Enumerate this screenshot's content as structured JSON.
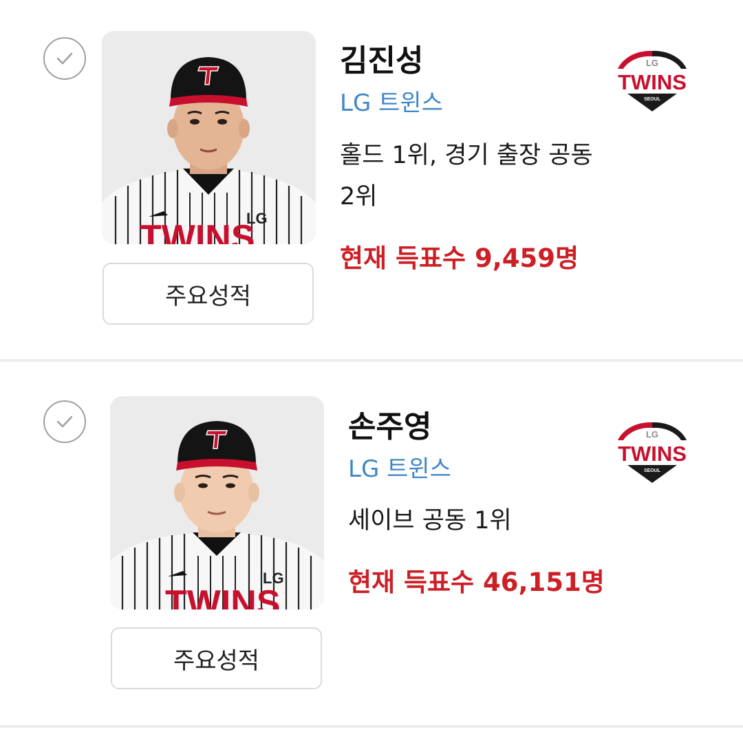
{
  "players": [
    {
      "name": "김진성",
      "team": "LG 트윈스",
      "description": "홀드 1위, 경기 출장 공동 2위",
      "votes": "현재 득표수 9,459명",
      "stats_button": "주요성적",
      "team_logo": {
        "small": "LG",
        "main": "TWINS",
        "sub": "SEOUL"
      }
    },
    {
      "name": "손주영",
      "team": "LG 트윈스",
      "description": "세이브 공동 1위",
      "votes": "현재 득표수 46,151명",
      "stats_button": "주요성적",
      "team_logo": {
        "small": "LG",
        "main": "TWINS",
        "sub": "SEOUL"
      }
    }
  ],
  "colors": {
    "team_link": "#3f86c7",
    "votes": "#cc1f26",
    "logo_red": "#c8102e",
    "logo_dark": "#1a1a1a"
  }
}
